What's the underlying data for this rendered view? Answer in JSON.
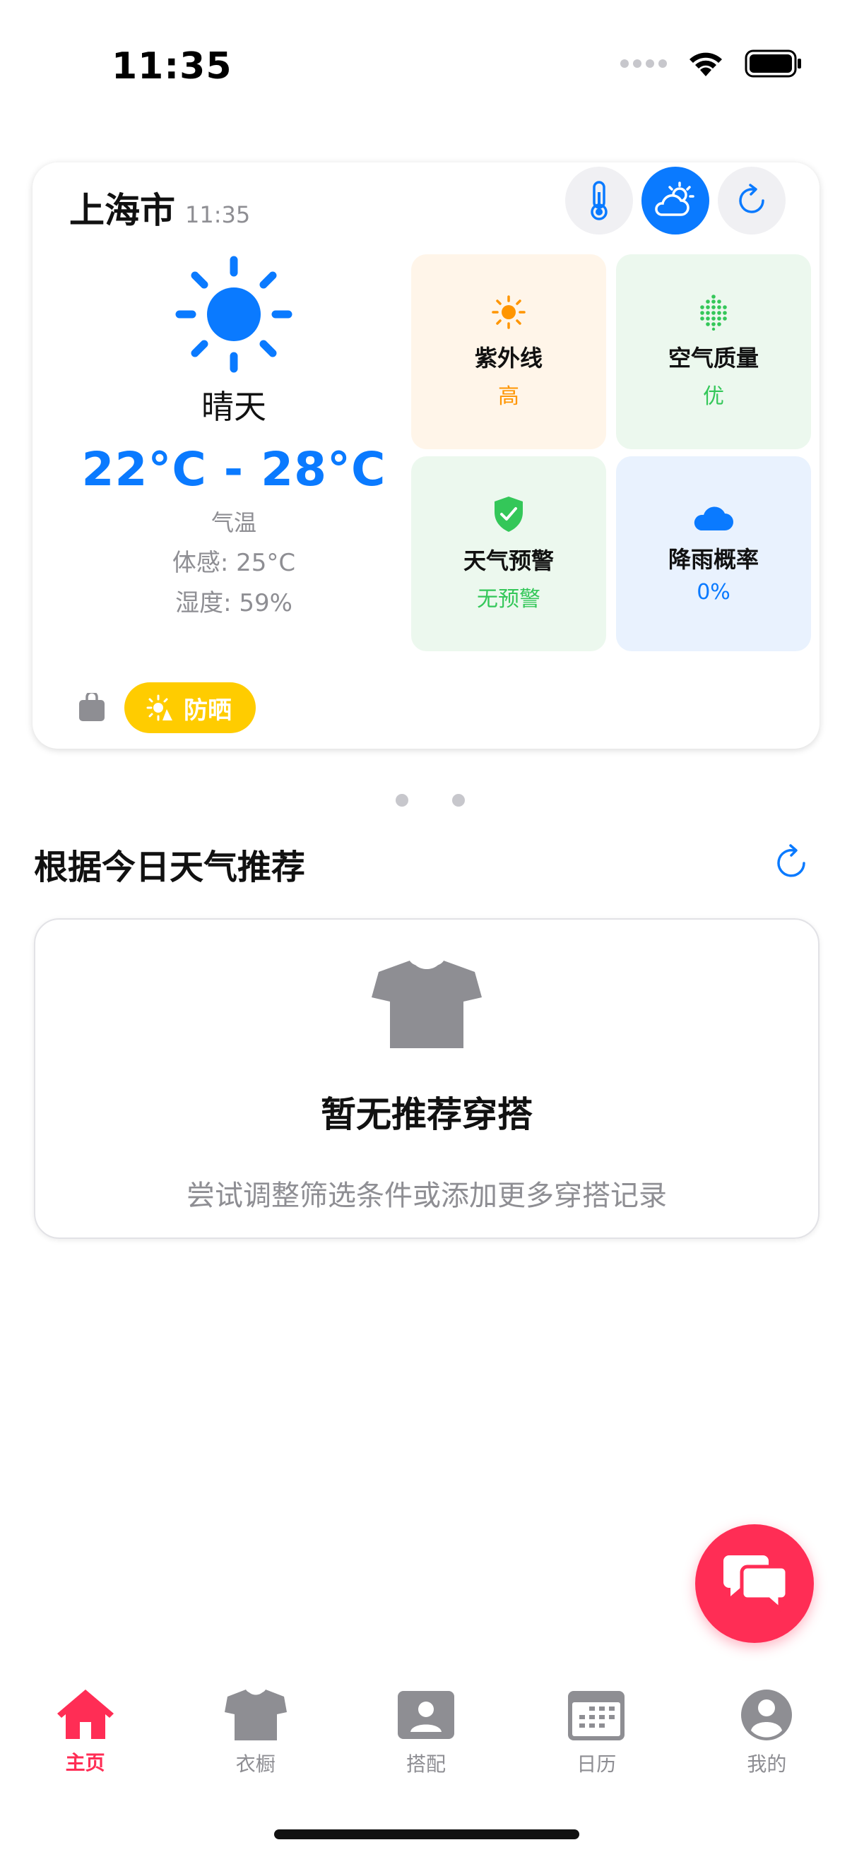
{
  "status_bar": {
    "time": "11:35"
  },
  "weather": {
    "city": "上海市",
    "update_time": "11:35",
    "condition": "晴天",
    "temp_range": "22°C - 28°C",
    "temp_label": "气温",
    "feels_like": "体感: 25°C",
    "humidity": "湿度: 59%",
    "tiles": [
      {
        "label": "紫外线",
        "value": "高",
        "icon": "sun-icon",
        "color": "#ff9500"
      },
      {
        "label": "空气质量",
        "value": "优",
        "icon": "dots-icon",
        "color": "#34c759"
      },
      {
        "label": "天气预警",
        "value": "无预警",
        "icon": "shield-icon",
        "color": "#34c759"
      },
      {
        "label": "降雨概率",
        "value": "0%",
        "icon": "cloud-icon",
        "color": "#0a7aff"
      }
    ],
    "tag": "防晒"
  },
  "recommend": {
    "title": "根据今日天气推荐",
    "empty_title": "暂无推荐穿搭",
    "empty_subtitle": "尝试调整筛选条件或添加更多穿搭记录"
  },
  "tabs": [
    {
      "label": "主页",
      "icon": "home-icon",
      "active": true
    },
    {
      "label": "衣橱",
      "icon": "shirt-icon",
      "active": false
    },
    {
      "label": "搭配",
      "icon": "person-card-icon",
      "active": false
    },
    {
      "label": "日历",
      "icon": "calendar-icon",
      "active": false
    },
    {
      "label": "我的",
      "icon": "profile-icon",
      "active": false
    }
  ],
  "colors": {
    "accent": "#0a7aff",
    "brand": "#ff2d55",
    "tag": "#ffcc00"
  }
}
